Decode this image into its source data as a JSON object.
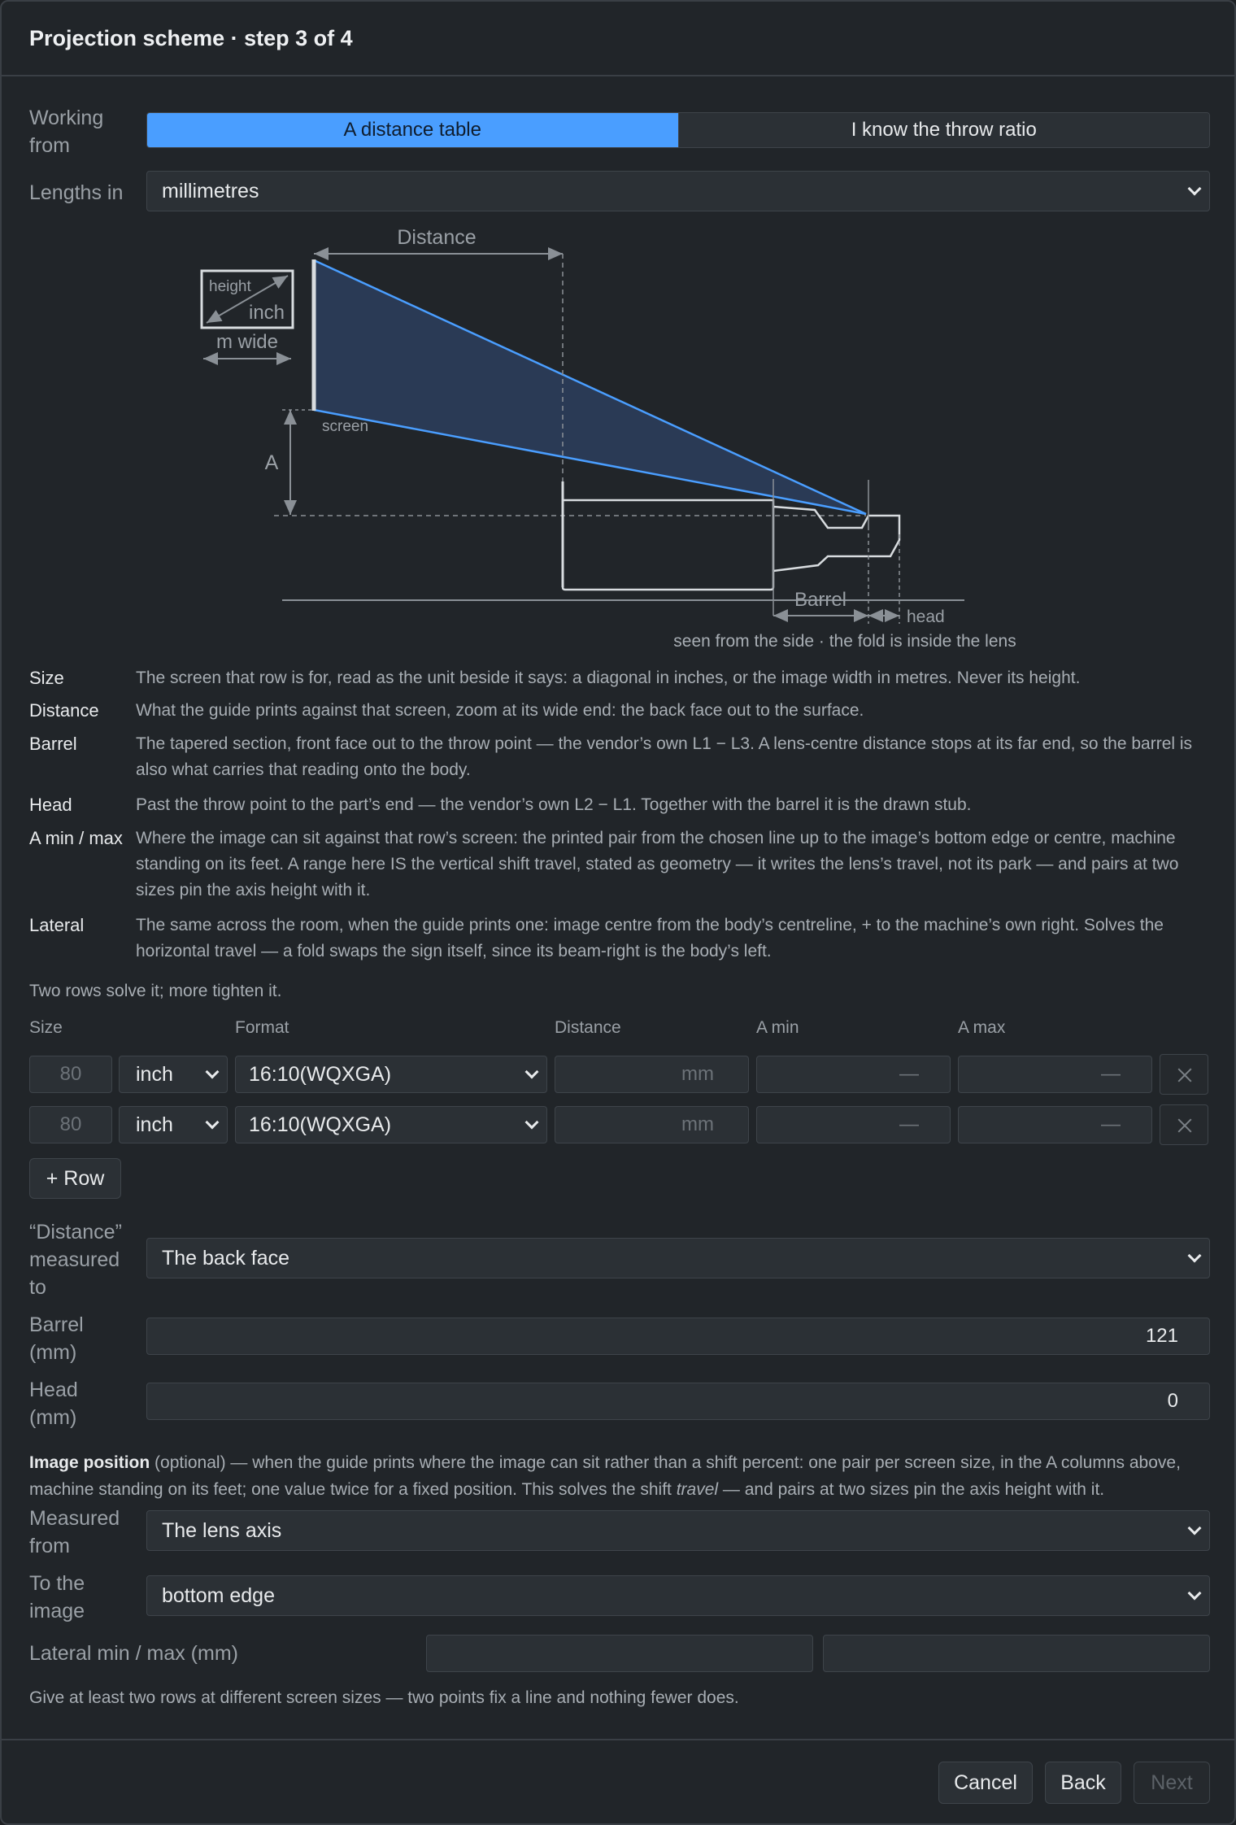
{
  "dialog": {
    "title": "Projection scheme · step 3 of 4"
  },
  "working_from": {
    "label": "Working\nfrom",
    "options": [
      "A distance table",
      "I know the throw ratio"
    ],
    "selected": "A distance table"
  },
  "lengths_in": {
    "label": "Lengths in",
    "value": "millimetres"
  },
  "diagram": {
    "distance": "Distance",
    "height": "height",
    "inch": "inch",
    "m_wide": "m wide",
    "screen": "screen",
    "a": "A",
    "barrel": "Barrel",
    "head": "head",
    "caption": "seen from the side · the fold is inside the lens"
  },
  "definitions": [
    {
      "term": "Size",
      "text": "The screen that row is for, read as the unit beside it says: a diagonal in inches, or the image width in metres. Never its height."
    },
    {
      "term": "Distance",
      "text": "What the guide prints against that screen, zoom at its wide end: the back face out to the surface."
    },
    {
      "term": "Barrel",
      "text": "The tapered section, front face out to the throw point — the vendor’s own L1 − L3. A lens-centre distance stops at its far end, so the barrel is also what carries that reading onto the body."
    },
    {
      "term": "Head",
      "text": "Past the throw point to the part’s end — the vendor’s own L2 − L1. Together with the barrel it is the drawn stub."
    },
    {
      "term": "A min / max",
      "text": "Where the image can sit against that row’s screen: the printed pair from the chosen line up to the image’s bottom edge or centre, machine standing on its feet. A range here IS the vertical shift travel, stated as geometry — it writes the lens’s travel, not its park — and pairs at two sizes pin the axis height with it."
    },
    {
      "term": "Lateral",
      "text": "The same across the room, when the guide prints one: image centre from the body’s centreline, + to the machine’s own right. Solves the horizontal travel — a fold swaps the sign itself, since its beam-right is the body’s left."
    }
  ],
  "rows_note": "Two rows solve it; more tighten it.",
  "table": {
    "headers": [
      "Size",
      "Format",
      "Distance",
      "A min",
      "A max"
    ],
    "rows": [
      {
        "size": "80",
        "unit": "inch",
        "format": "16:10(WQXGA)",
        "distance": "mm",
        "a_min": "—",
        "a_max": "—"
      },
      {
        "size": "80",
        "unit": "inch",
        "format": "16:10(WQXGA)",
        "distance": "mm",
        "a_min": "—",
        "a_max": "—"
      }
    ],
    "add_row": "+ Row"
  },
  "distance_to": {
    "label": "“Distance” measured to",
    "value": "The back face"
  },
  "barrel": {
    "label": "Barrel (mm)",
    "value": "121"
  },
  "head": {
    "label": "Head (mm)",
    "value": "0"
  },
  "image_position": {
    "title": "Image position",
    "text_a": " (optional) — when the guide prints where the image can sit rather than a shift percent: one pair per screen size, in the A columns above, machine standing on its feet; one value twice for a fixed position. This solves the shift ",
    "text_em": "travel",
    "text_b": " — and pairs at two sizes pin the axis height with it."
  },
  "measured_from": {
    "label": "Measured from",
    "value": "The lens axis"
  },
  "to_image": {
    "label": "To the image",
    "value": "bottom edge"
  },
  "lateral": {
    "label": "Lateral min / max (mm)",
    "min": "",
    "max": ""
  },
  "bottom_note": "Give at least two rows at different screen sizes — two points fix a line and nothing fewer does.",
  "footer": {
    "cancel": "Cancel",
    "back": "Back",
    "next": "Next"
  },
  "colors": {
    "accent": "#4a9eff",
    "background": "#212529"
  }
}
